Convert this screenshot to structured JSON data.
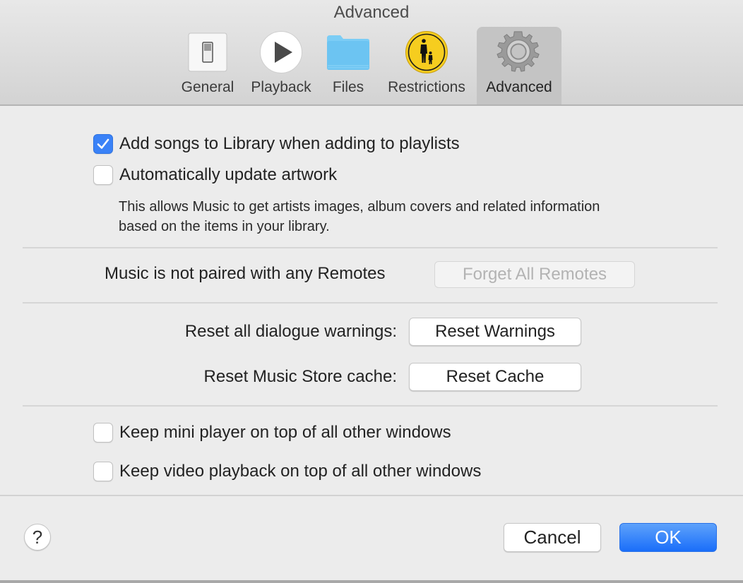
{
  "window": {
    "title": "Advanced"
  },
  "tabs": [
    {
      "label": "General",
      "icon": "switch-icon",
      "selected": false
    },
    {
      "label": "Playback",
      "icon": "play-icon",
      "selected": false
    },
    {
      "label": "Files",
      "icon": "folder-icon",
      "selected": false
    },
    {
      "label": "Restrictions",
      "icon": "parental-controls-icon",
      "selected": false
    },
    {
      "label": "Advanced",
      "icon": "gear-icon",
      "selected": true
    }
  ],
  "options": {
    "add_songs": {
      "label": "Add songs to Library when adding to playlists",
      "checked": true
    },
    "update_artwork": {
      "label": "Automatically update artwork",
      "checked": false
    },
    "artwork_note": "This allows Music to get artists images, album covers and related information based on the items in your library."
  },
  "remotes": {
    "status": "Music is not paired with any Remotes",
    "forget_button": "Forget All Remotes",
    "forget_enabled": false
  },
  "resets": {
    "warnings_label": "Reset all dialogue warnings:",
    "warnings_button": "Reset Warnings",
    "cache_label": "Reset Music Store cache:",
    "cache_button": "Reset Cache"
  },
  "windows": {
    "mini_player": {
      "label": "Keep mini player on top of all other windows",
      "checked": false
    },
    "video_playback": {
      "label": "Keep video playback on top of all other windows",
      "checked": false
    }
  },
  "footer": {
    "help": "?",
    "cancel": "Cancel",
    "ok": "OK"
  },
  "colors": {
    "accent": "#3a82f7",
    "ok_button": "#1a6ef9"
  }
}
